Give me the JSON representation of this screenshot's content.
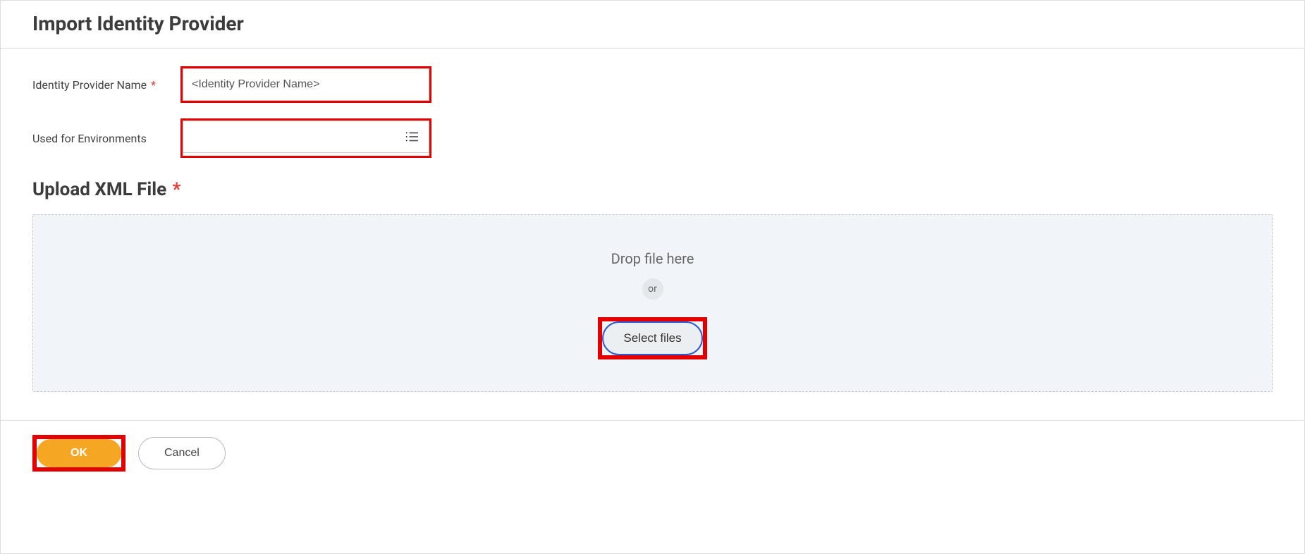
{
  "header": {
    "title": "Import Identity Provider"
  },
  "form": {
    "name_label": "Identity Provider Name",
    "name_placeholder": "<Identity Provider Name>",
    "env_label": "Used for Environments"
  },
  "upload": {
    "section_title": "Upload XML File",
    "drop_text": "Drop file here",
    "or_text": "or",
    "select_btn": "Select files"
  },
  "footer": {
    "ok": "OK",
    "cancel": "Cancel"
  }
}
